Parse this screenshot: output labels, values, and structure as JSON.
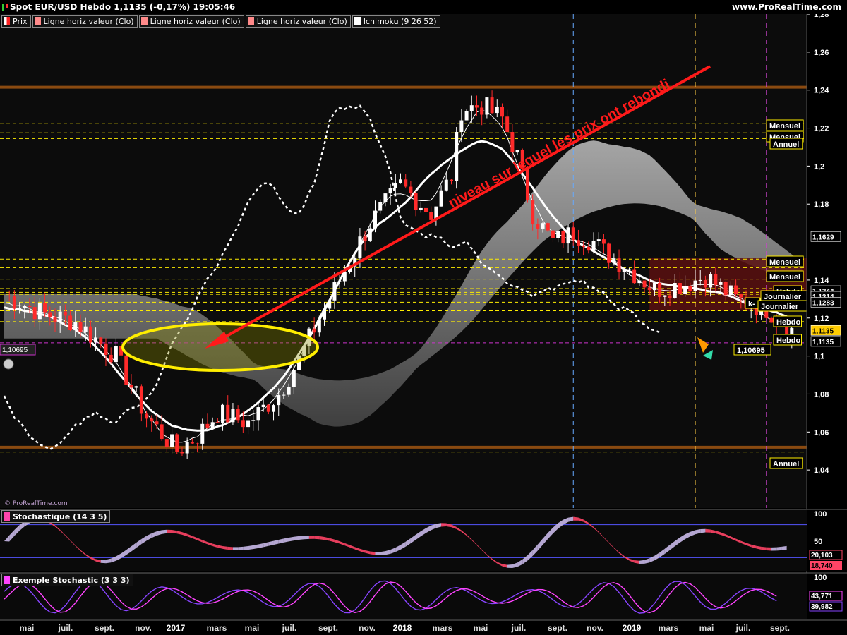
{
  "header": {
    "title": "Spot EUR/USD Hebdo 1,1135 (-0,17%) 19:05:46",
    "site": "www.ProRealTime.com"
  },
  "legend": [
    {
      "label": "Prix",
      "color": "#ffffff",
      "icon": "candle-icon"
    },
    {
      "label": "Ligne horiz valeur (Clo)",
      "color": "#ff8a8a"
    },
    {
      "label": "Ligne horiz valeur (Clo)",
      "color": "#ff8a8a"
    },
    {
      "label": "Ligne horiz valeur (Clo)",
      "color": "#ff8a8a"
    },
    {
      "label": "Ichimoku (9 26 52)",
      "color": "#ffffff"
    }
  ],
  "watermark": "© ProRealTime.com",
  "annotation": {
    "text": "niveau sur lequel les prix ont rebondi",
    "color": "#ff1a1a"
  },
  "price_badge": "1,10695",
  "colors": {
    "bull": "#ffffff",
    "bear": "#ff2a2a",
    "cloud": "#8a8a8a",
    "accent_yellow": "#ffee00",
    "level_brown": "#8a4a10",
    "stoch_up": "#c8b8e8",
    "stoch_down": "#ff4466",
    "ex_stoch_k": "#8844ff",
    "ex_stoch_d": "#ff44ff"
  },
  "chart_data": [
    {
      "type": "candlestick",
      "title": "Spot EUR/USD Hebdo",
      "ylim": [
        1.02,
        1.28
      ],
      "yticks": [
        "1,28",
        "1,26",
        "1,24",
        "1,22",
        "1,2",
        "1,18",
        "1,1629",
        "1,14",
        "1,1344",
        "1,1314",
        "1,1283",
        "1,12",
        "1,1135",
        "1,1",
        "1,08",
        "1,06",
        "1,04"
      ],
      "xticks": [
        "mai",
        "juil.",
        "sept.",
        "nov.",
        "2017",
        "mars",
        "mai",
        "juil.",
        "sept.",
        "nov.",
        "2018",
        "mars",
        "mai",
        "juil.",
        "sept.",
        "nov.",
        "2019",
        "mars",
        "mai",
        "juil.",
        "sept."
      ],
      "last_price": "1,1135",
      "horizontal_levels": [
        {
          "label": "Mensuel",
          "value": 1.2225,
          "color": "#ffee00"
        },
        {
          "label": "Mensuel",
          "value": 1.2175,
          "color": "#ffee00"
        },
        {
          "label": "Annuel",
          "value": 1.2145,
          "color": "#ffee00"
        },
        {
          "label": "Annuel",
          "value": 1.2415,
          "color": "#8a4a10"
        },
        {
          "label": "Mensuel",
          "value": 1.151,
          "color": "#ffee00"
        },
        {
          "label": "Mensuel",
          "value": 1.1465,
          "color": "#ffee00"
        },
        {
          "label": "Hebdo",
          "value": 1.1405,
          "color": "#ffee00"
        },
        {
          "label": "Journalier",
          "value": 1.1355,
          "color": "#ffee00"
        },
        {
          "label": "k-",
          "value": 1.1335,
          "color": "#ffee00"
        },
        {
          "label": "Journalier",
          "value": 1.1325,
          "color": "#ffee00"
        },
        {
          "label": "Hebdo",
          "value": 1.1283,
          "color": "#ffee00"
        },
        {
          "label": "Hebdo",
          "value": 1.1238,
          "color": "#ffee00"
        },
        {
          "label": "Hebdo",
          "value": 1.1181,
          "color": "#ffee00"
        },
        {
          "label": "1,10695",
          "value": 1.10695,
          "color": "#cc33cc"
        },
        {
          "label": "Annuel",
          "value": 1.052,
          "color": "#8a4a10"
        },
        {
          "label": "Annuel",
          "value": 1.0495,
          "color": "#ffee00"
        }
      ],
      "right_price_labels": [
        "1,1629",
        "1,1344",
        "1,1314",
        "1,1283",
        "1,1135",
        "1,1135"
      ]
    },
    {
      "type": "area",
      "title": "Stochastique (14 3 5)",
      "yticks": [
        "100",
        "50"
      ],
      "ylim": [
        0,
        100
      ],
      "levels": [
        80,
        20
      ],
      "values_shown": [
        "20,103",
        "18,740"
      ]
    },
    {
      "type": "line",
      "title": "Exemple Stochastic (3 3 3)",
      "yticks": [
        "100",
        "50"
      ],
      "ylim": [
        0,
        100
      ],
      "values_shown": [
        "43,771",
        "39,982"
      ]
    }
  ]
}
